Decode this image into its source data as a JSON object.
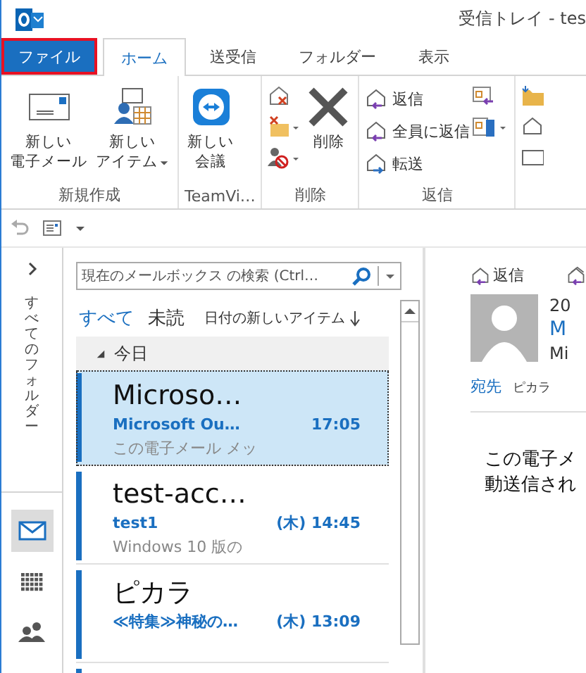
{
  "window": {
    "title": "受信トレイ - tes"
  },
  "ribbon_tabs": [
    {
      "label": "ファイル",
      "kind": "file",
      "selected": false
    },
    {
      "label": "ホーム",
      "kind": "tab",
      "selected": true
    },
    {
      "label": "送受信",
      "kind": "tab",
      "selected": false
    },
    {
      "label": "フォルダー",
      "kind": "tab",
      "selected": false
    },
    {
      "label": "表示",
      "kind": "tab",
      "selected": false
    }
  ],
  "ribbon": {
    "new_group": {
      "label": "新規作成",
      "new_email": [
        "新しい",
        "電子メール"
      ],
      "new_item": [
        "新しい",
        "アイテム"
      ]
    },
    "teamviewer_group": {
      "label": "TeamVi…",
      "new_meeting": [
        "新しい",
        "会議"
      ]
    },
    "delete_group": {
      "label": "削除",
      "delete": "削除"
    },
    "respond_group": {
      "label": "返信",
      "reply": "返信",
      "reply_all": "全員に返信",
      "forward": "転送"
    }
  },
  "folder_pane": {
    "label": "すべてのフォルダー",
    "nav": [
      {
        "kind": "mail",
        "selected": true
      },
      {
        "kind": "calendar",
        "selected": false
      },
      {
        "kind": "people",
        "selected": false
      }
    ]
  },
  "message_list": {
    "search": {
      "placeholder": "現在のメールボックス の検索 (Ctrl…"
    },
    "filters": [
      {
        "label": "すべて",
        "selected": true
      },
      {
        "label": "未読",
        "selected": false
      }
    ],
    "sort": "日付の新しいアイテム",
    "group_header": "今日",
    "messages": [
      {
        "sender": "Microso…",
        "subject": "Microsoft Ou…",
        "time": "17:05",
        "preview": "この電子メール メッ",
        "selected": true
      },
      {
        "sender": "test-acc…",
        "subject": "test1",
        "time": "(木) 14:45",
        "preview": "Windows 10 版の",
        "selected": false
      },
      {
        "sender": "ピカラ",
        "subject": "≪特集≫神秘の…",
        "time": "(木) 13:09",
        "selected": false
      }
    ]
  },
  "reading_pane": {
    "reply": "返信",
    "date": "20",
    "sender": "M",
    "sender_address": "Mi",
    "to_label": "宛先",
    "recipient": "ピカラ",
    "body": [
      "この電子メ",
      "動送信され"
    ]
  }
}
